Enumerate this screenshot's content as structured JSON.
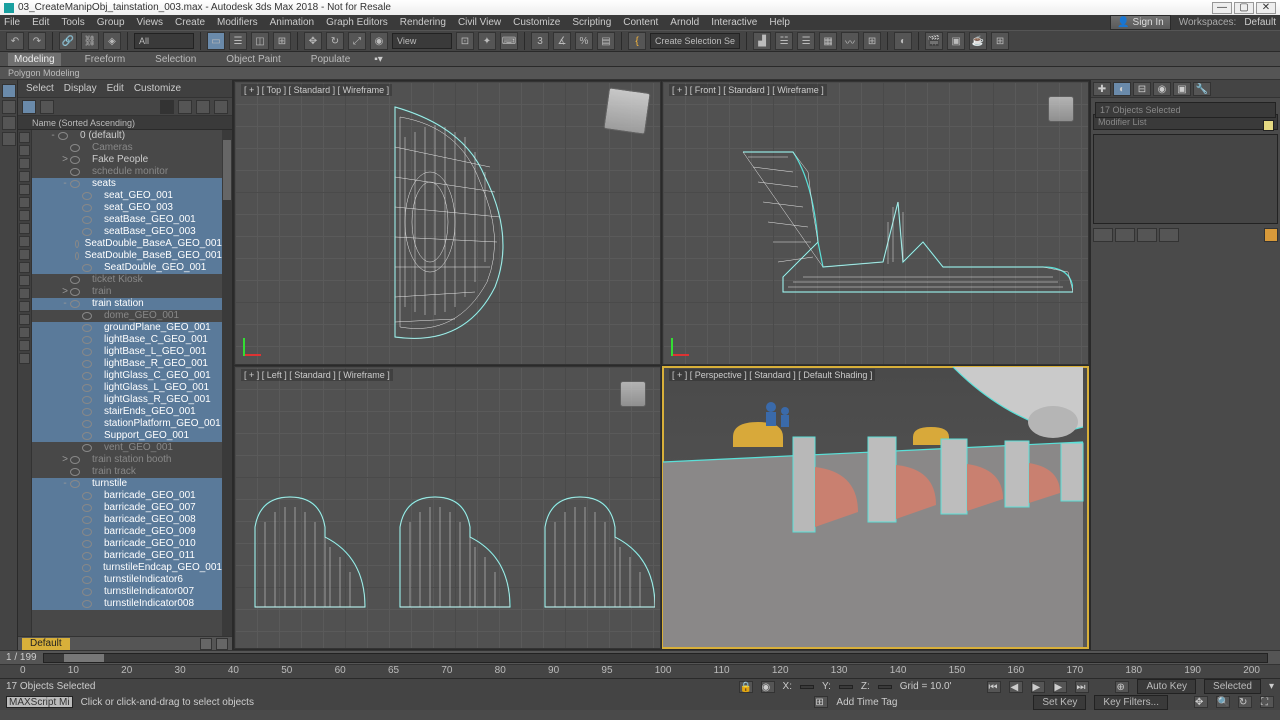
{
  "title": "03_CreateManipObj_tainstation_003.max - Autodesk 3ds Max 2018 - Not for Resale",
  "winbtns": {
    "min": "—",
    "max": "▢",
    "close": "✕"
  },
  "menus": [
    "File",
    "Edit",
    "Tools",
    "Group",
    "Views",
    "Create",
    "Modifiers",
    "Animation",
    "Graph Editors",
    "Rendering",
    "Civil View",
    "Customize",
    "Scripting",
    "Content",
    "Arnold",
    "Interactive",
    "Help"
  ],
  "signin": "Sign In",
  "workspaces": "Workspaces: ",
  "workspace": "Default",
  "toolbar": {
    "all": "All",
    "view": "View",
    "selset": "Create Selection Se"
  },
  "ribbon": {
    "tabs": [
      "Modeling",
      "Freeform",
      "Selection",
      "Object Paint",
      "Populate"
    ],
    "sub": "Polygon Modeling"
  },
  "scene": {
    "tabs": [
      "Select",
      "Display",
      "Edit",
      "Customize"
    ],
    "header": "Name (Sorted Ascending)",
    "tree": [
      {
        "l": "0 (default)",
        "d": 1,
        "exp": "-"
      },
      {
        "l": "Cameras",
        "d": 2,
        "dim": true
      },
      {
        "l": "Fake People",
        "d": 2,
        "exp": ">"
      },
      {
        "l": "schedule monitor",
        "d": 2,
        "dim": true
      },
      {
        "l": "seats",
        "d": 2,
        "sel": true,
        "exp": "-"
      },
      {
        "l": "seat_GEO_001",
        "d": 3,
        "sel": true
      },
      {
        "l": "seat_GEO_003",
        "d": 3,
        "sel": true
      },
      {
        "l": "seatBase_GEO_001",
        "d": 3,
        "sel": true
      },
      {
        "l": "seatBase_GEO_003",
        "d": 3,
        "sel": true
      },
      {
        "l": "SeatDouble_BaseA_GEO_001",
        "d": 3,
        "sel": true
      },
      {
        "l": "SeatDouble_BaseB_GEO_001",
        "d": 3,
        "sel": true
      },
      {
        "l": "SeatDouble_GEO_001",
        "d": 3,
        "sel": true
      },
      {
        "l": "ticket Kiosk",
        "d": 2,
        "dim": true
      },
      {
        "l": "train",
        "d": 2,
        "exp": ">",
        "dim": true
      },
      {
        "l": "train station",
        "d": 2,
        "sel": true,
        "exp": "-"
      },
      {
        "l": "dome_GEO_001",
        "d": 3,
        "dim": true
      },
      {
        "l": "groundPlane_GEO_001",
        "d": 3,
        "sel": true
      },
      {
        "l": "lightBase_C_GEO_001",
        "d": 3,
        "sel": true
      },
      {
        "l": "lightBase_L_GEO_001",
        "d": 3,
        "sel": true
      },
      {
        "l": "lightBase_R_GEO_001",
        "d": 3,
        "sel": true
      },
      {
        "l": "lightGlass_C_GEO_001",
        "d": 3,
        "sel": true
      },
      {
        "l": "lightGlass_L_GEO_001",
        "d": 3,
        "sel": true
      },
      {
        "l": "lightGlass_R_GEO_001",
        "d": 3,
        "sel": true
      },
      {
        "l": "stairEnds_GEO_001",
        "d": 3,
        "sel": true
      },
      {
        "l": "stationPlatform_GEO_001",
        "d": 3,
        "sel": true
      },
      {
        "l": "Support_GEO_001",
        "d": 3,
        "sel": true
      },
      {
        "l": "vent_GEO_001",
        "d": 3,
        "dim": true
      },
      {
        "l": "train station booth",
        "d": 2,
        "exp": ">",
        "dim": true
      },
      {
        "l": "train track",
        "d": 2,
        "dim": true
      },
      {
        "l": "turnstile",
        "d": 2,
        "sel": true,
        "exp": "-"
      },
      {
        "l": "barricade_GEO_001",
        "d": 3,
        "sel": true
      },
      {
        "l": "barricade_GEO_007",
        "d": 3,
        "sel": true
      },
      {
        "l": "barricade_GEO_008",
        "d": 3,
        "sel": true
      },
      {
        "l": "barricade_GEO_009",
        "d": 3,
        "sel": true
      },
      {
        "l": "barricade_GEO_010",
        "d": 3,
        "sel": true
      },
      {
        "l": "barricade_GEO_011",
        "d": 3,
        "sel": true
      },
      {
        "l": "turnstileEndcap_GEO_001",
        "d": 3,
        "sel": true
      },
      {
        "l": "turnstileIndicator6",
        "d": 3,
        "sel": true
      },
      {
        "l": "turnstileIndicator007",
        "d": 3,
        "sel": true
      },
      {
        "l": "turnstileIndicator008",
        "d": 3,
        "sel": true
      }
    ],
    "footer": "Default"
  },
  "viewports": {
    "tl": "[ + ] [ Top ] [ Standard ] [ Wireframe ]",
    "tr": "[ + ] [ Front ] [ Standard ] [ Wireframe ]",
    "bl": "[ + ] [ Left ] [ Standard ] [ Wireframe ]",
    "br": "[ + ] [ Perspective ] [ Standard ] [ Default Shading ]"
  },
  "cmdpanel": {
    "info": "17 Objects Selected",
    "mod": "Modifier List"
  },
  "timeline": {
    "frame": "1 / 199"
  },
  "ruler": [
    "0",
    "10",
    "20",
    "30",
    "40",
    "50",
    "60",
    "65",
    "70",
    "80",
    "90",
    "95",
    "100",
    "110",
    "120",
    "130",
    "140",
    "150",
    "160",
    "170",
    "180",
    "190",
    "200"
  ],
  "status": {
    "objects": "17 Objects Selected",
    "hint": "Click or click-and-drag to select objects",
    "x": "X:",
    "y": "Y:",
    "z": "Z:",
    "grid": "Grid = 10.0'",
    "maxscript": "MAXScript Mi",
    "autokey": "Auto Key",
    "selected": "Selected",
    "setkey": "Set Key",
    "filters": "Key Filters...",
    "addtag": "Add Time Tag"
  }
}
